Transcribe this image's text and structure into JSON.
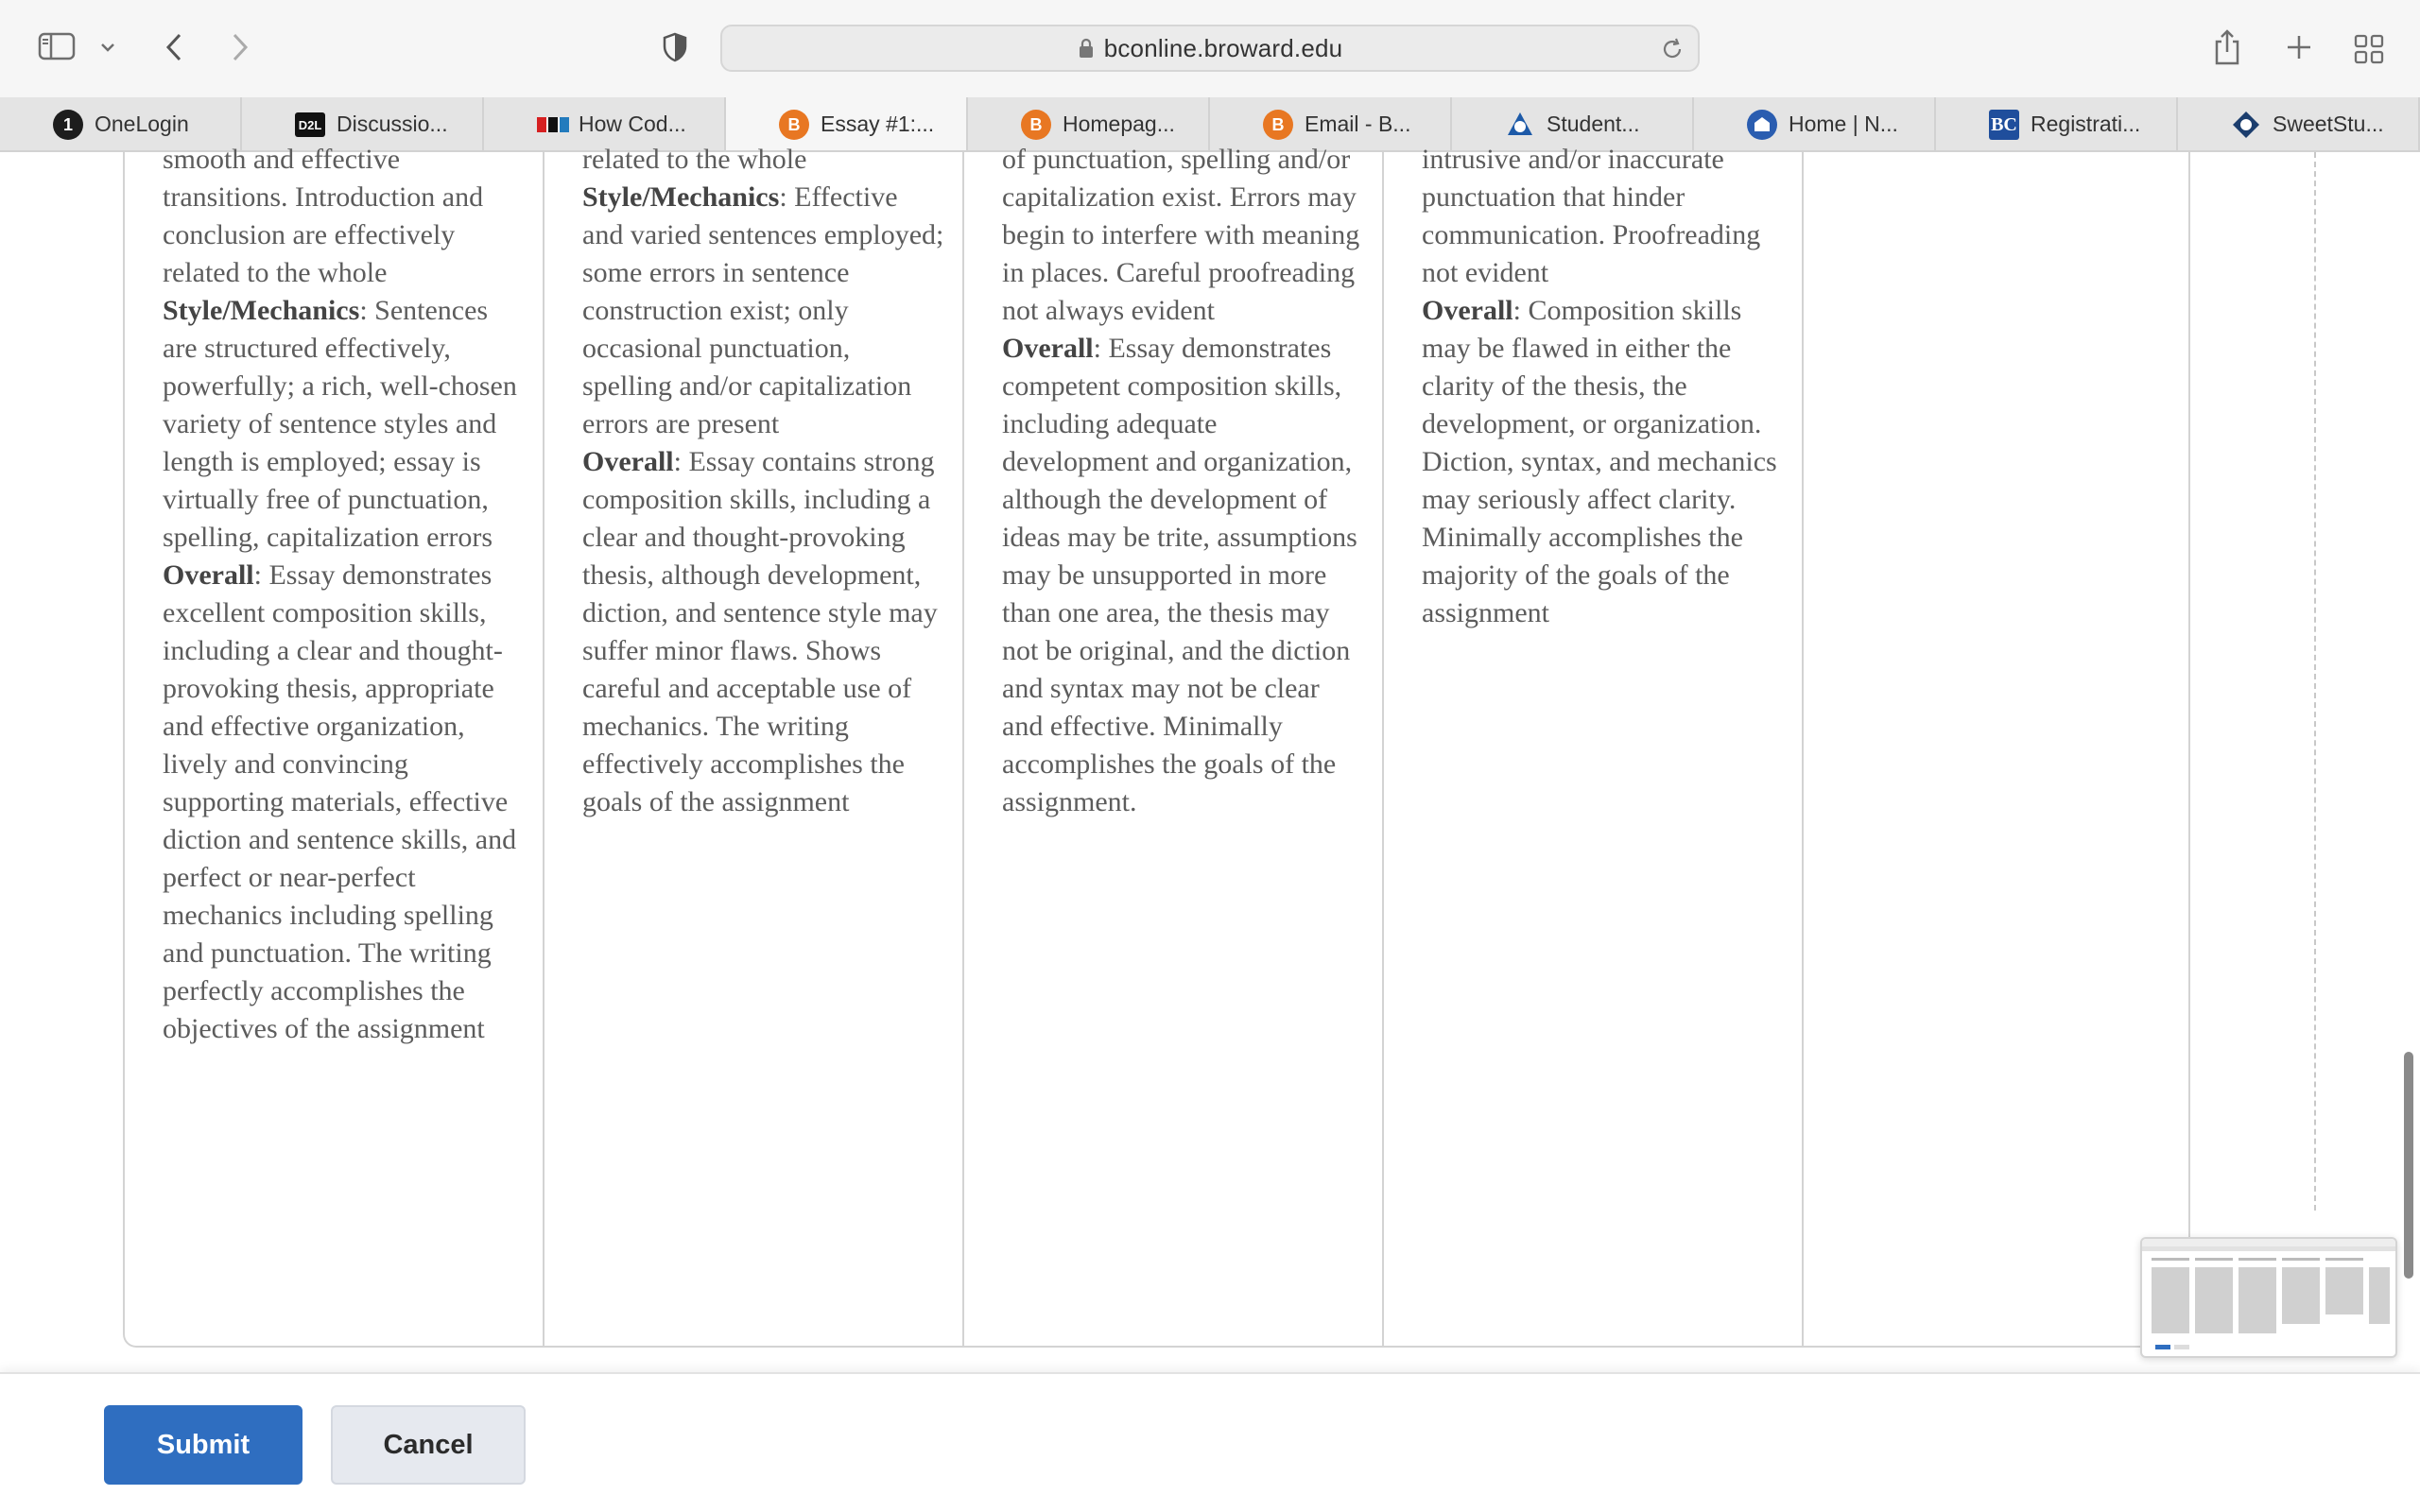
{
  "browser": {
    "url": "bconline.broward.edu",
    "tabs": [
      {
        "label": "OneLogin",
        "favicon": "onelogin-icon",
        "favicon_text": "1"
      },
      {
        "label": "Discussio...",
        "favicon": "d2l-icon",
        "favicon_text": "D2L"
      },
      {
        "label": "How Cod...",
        "favicon": "npr-icon",
        "favicon_text": ""
      },
      {
        "label": "Essay #1:...",
        "favicon": "brightspace-icon",
        "favicon_text": "B",
        "active": true
      },
      {
        "label": "Homepag...",
        "favicon": "brightspace-icon",
        "favicon_text": "B"
      },
      {
        "label": "Email - B...",
        "favicon": "brightspace-icon",
        "favicon_text": "B"
      },
      {
        "label": "Student...",
        "favicon": "student-icon",
        "favicon_text": ""
      },
      {
        "label": "Home | N...",
        "favicon": "home-institution-icon",
        "favicon_text": ""
      },
      {
        "label": "Registrati...",
        "favicon": "bc-icon",
        "favicon_text": "BC"
      },
      {
        "label": "SweetStu...",
        "favicon": "sweetstudy-icon",
        "favicon_text": ""
      }
    ]
  },
  "rubric": {
    "columns": [
      {
        "segments": [
          {
            "t": "smooth and effective transitions. Introduction and conclusion are effectively related to the whole"
          },
          {
            "b": "Style/Mechanics",
            "t": ": Sentences are structured effectively, powerfully; a rich, well-chosen variety of sentence styles and length is employed; essay is virtually free of punctuation, spelling, capitalization errors"
          },
          {
            "b": "Overall",
            "t": ": Essay demonstrates excellent composition skills, including a clear and thought-provoking thesis, appropriate and effective organization, lively and convincing supporting materials, effective diction and sentence skills, and perfect or near-perfect mechanics including spelling and punctuation. The writing perfectly accomplishes the objectives of the assignment"
          }
        ]
      },
      {
        "segments": [
          {
            "t": "related to the whole"
          },
          {
            "b": "Style/Mechanics",
            "t": ": Effective and varied sentences employed; some errors in sentence construction exist; only occasional punctuation, spelling and/or capitalization errors are present"
          },
          {
            "b": "Overall",
            "t": ": Essay contains strong composition skills, including a clear and thought-provoking thesis, although development, diction, and sentence style may suffer minor flaws. Shows careful and acceptable use of mechanics. The writing effectively accomplishes the goals of the assignment"
          }
        ]
      },
      {
        "segments": [
          {
            "t": "of punctuation, spelling and/or capitalization exist. Errors may begin to interfere with meaning in places. Careful proofreading not always evident"
          },
          {
            "b": "Overall",
            "t": ": Essay demonstrates competent composition skills, including adequate development and organization, although the development of ideas may be trite, assumptions may be unsupported in more than one area, the thesis may not be original, and the diction and syntax may not be clear and effective. Minimally accomplishes the goals of the assignment."
          }
        ]
      },
      {
        "segments": [
          {
            "t": "intrusive and/or inaccurate punctuation that hinder communication. Proofreading not evident"
          },
          {
            "b": "Overall",
            "t": ": Composition skills may be flawed in either the clarity of the thesis, the development, or organization. Diction, syntax, and mechanics may seriously affect clarity. Minimally accomplishes the majority of the goals of the assignment"
          }
        ]
      },
      {
        "segments": []
      }
    ]
  },
  "footer": {
    "submit_label": "Submit",
    "cancel_label": "Cancel"
  },
  "colors": {
    "accent": "#2f6ec0",
    "brightspace": "#e87722"
  }
}
